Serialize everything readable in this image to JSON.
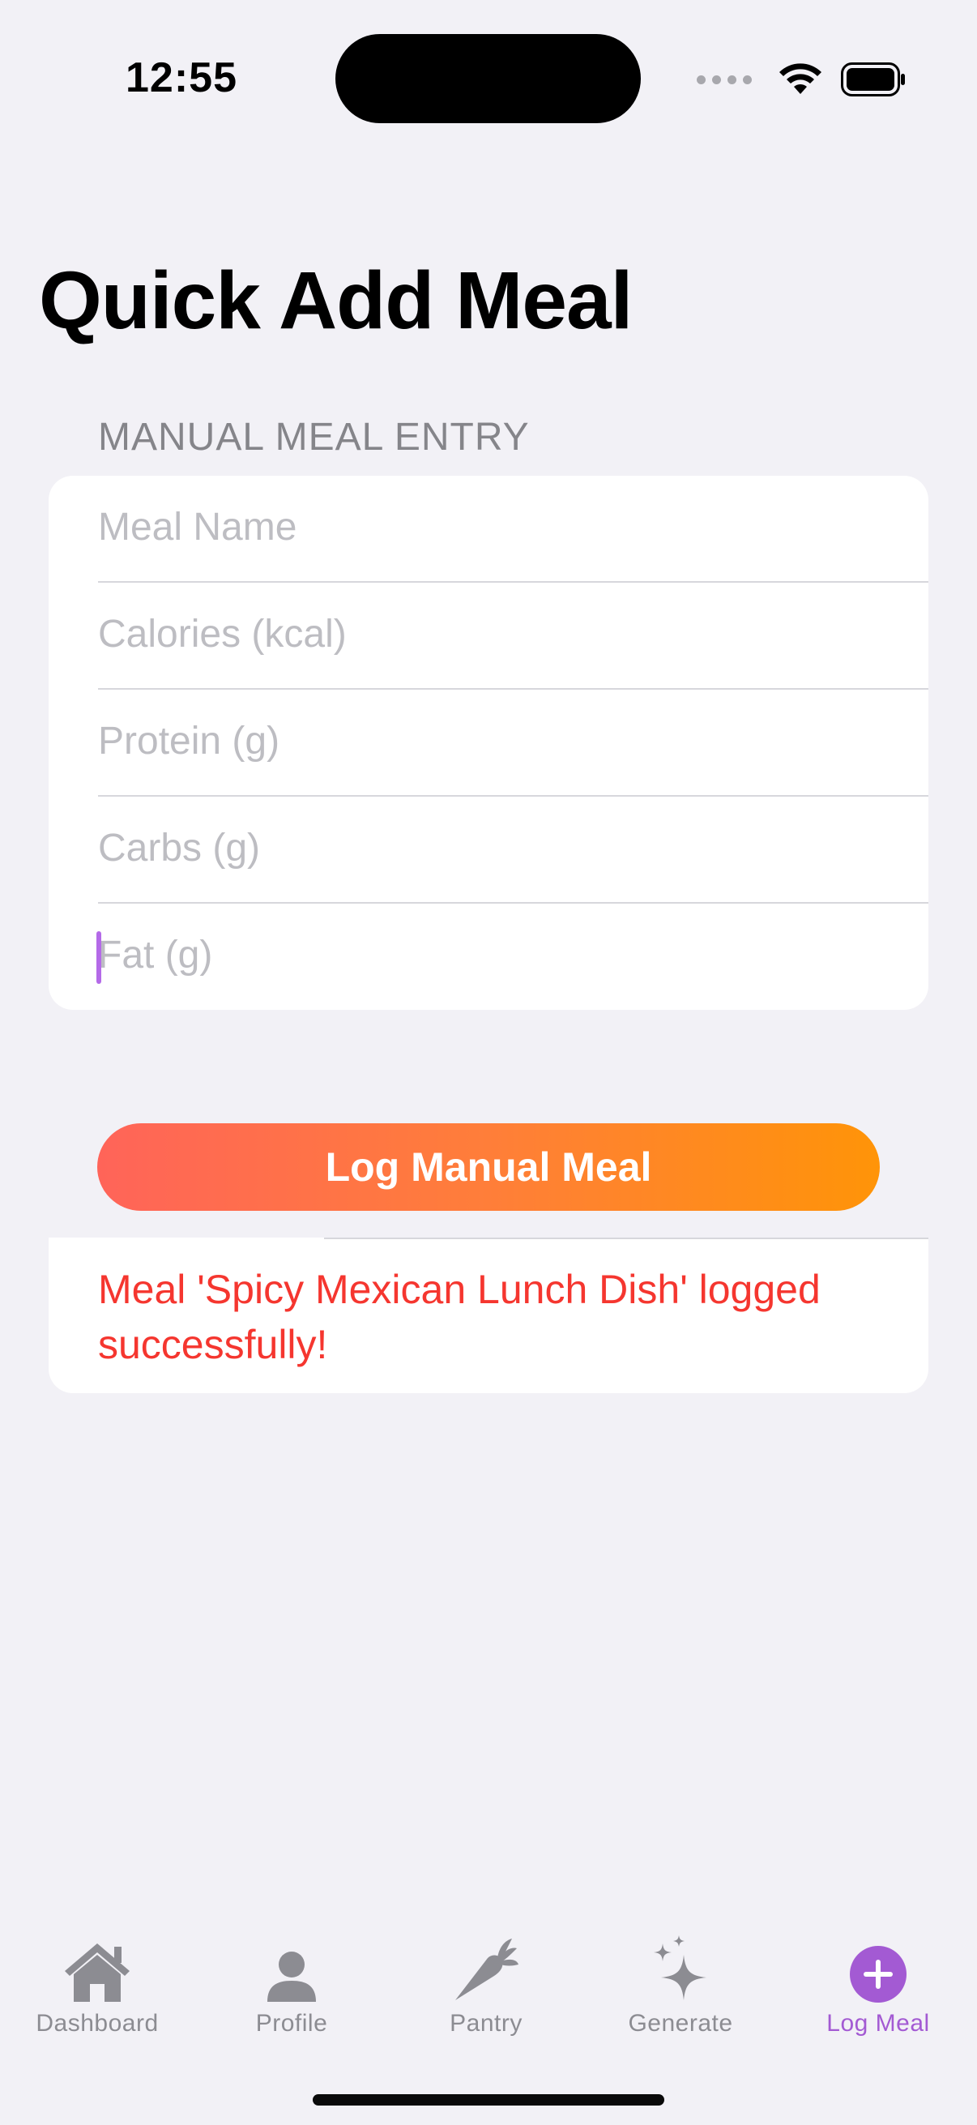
{
  "status_bar": {
    "time": "12:55"
  },
  "page": {
    "title": "Quick Add Meal"
  },
  "form": {
    "section_header": "MANUAL MEAL ENTRY",
    "fields": {
      "meal_name": {
        "placeholder": "Meal Name",
        "value": ""
      },
      "calories": {
        "placeholder": "Calories (kcal)",
        "value": ""
      },
      "protein": {
        "placeholder": "Protein (g)",
        "value": ""
      },
      "carbs": {
        "placeholder": "Carbs (g)",
        "value": ""
      },
      "fat": {
        "placeholder": "Fat (g)",
        "value": ""
      }
    },
    "submit_label": "Log Manual Meal"
  },
  "result_message": "Meal 'Spicy Mexican Lunch Dish' logged successfully!",
  "tab_bar": {
    "active": "Log Meal",
    "items": [
      {
        "label": "Dashboard",
        "icon": "house-icon"
      },
      {
        "label": "Profile",
        "icon": "person-icon"
      },
      {
        "label": "Pantry",
        "icon": "carrot-icon"
      },
      {
        "label": "Generate",
        "icon": "sparkles-icon"
      },
      {
        "label": "Log Meal",
        "icon": "plus-circle-icon"
      }
    ]
  },
  "colors": {
    "accent": "#A35AD3",
    "error_text": "#F5362F",
    "button_gradient_start": "#FF6459",
    "button_gradient_end": "#FF9408",
    "background": "#F2F1F6"
  }
}
